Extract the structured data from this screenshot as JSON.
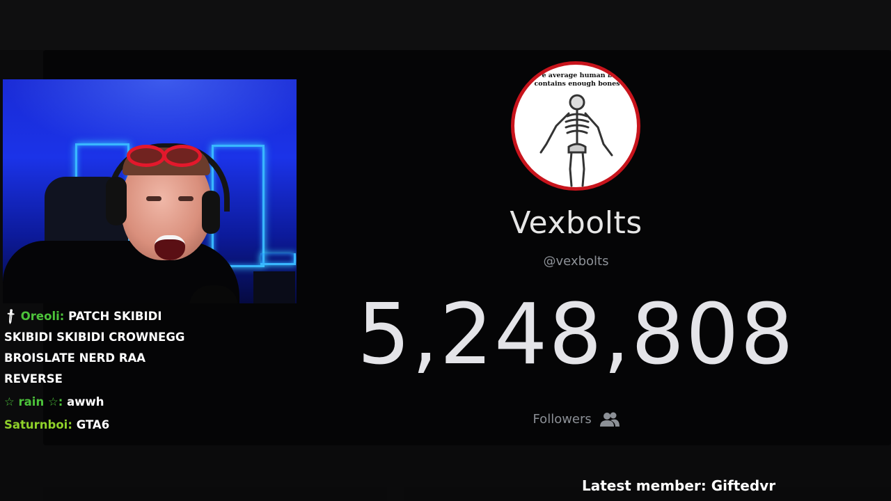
{
  "chat": [
    {
      "badge_icon": "sword-icon",
      "user": "Oreoli",
      "user_color": "#4cc23a",
      "lines": [
        "PATCH SKIBIDI",
        "SKIBIDI SKIBIDI CROWNEGG",
        "BROISLATE NERD RAA",
        "REVERSE"
      ]
    },
    {
      "user": "☆ rain ☆",
      "user_color": "#4cc23a",
      "text": "awwh"
    },
    {
      "user": "Saturnboi",
      "user_color": "#8fd12a",
      "text": "GTA6"
    }
  ],
  "profile": {
    "avatar_caption": "e average human b\ncontains enough bones",
    "display_name": "Vexbolts",
    "handle": "@vexbolts",
    "follower_count": "5,248,808",
    "followers_label": "Followers",
    "followers_icon": "users-icon",
    "accent_color": "#c8141c"
  },
  "footer": {
    "latest_member": "Latest member: Giftedvr"
  }
}
